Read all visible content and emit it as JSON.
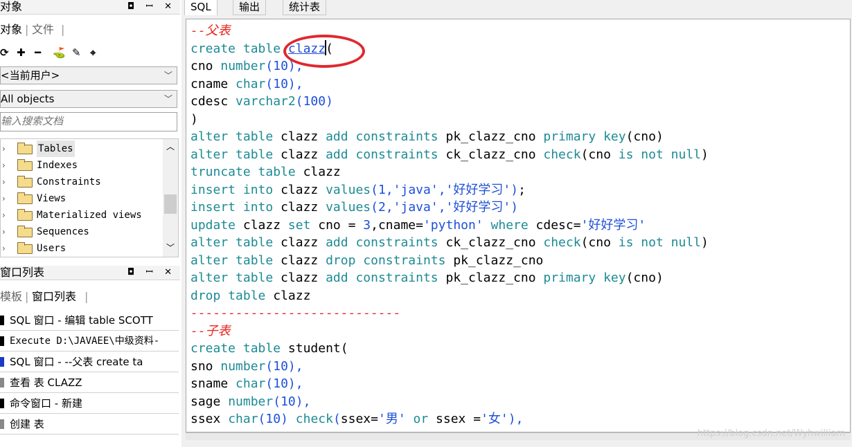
{
  "objects_panel": {
    "title": "对象",
    "controls": "◘ ꟷ ✕",
    "tabs": [
      "对象",
      "文件"
    ],
    "toolbar_icons": [
      "refresh-icon",
      "add-icon",
      "remove-icon",
      "find-icon",
      "filter-icon",
      "properties-icon"
    ],
    "user_select": "<当前用户>",
    "type_select": "All objects",
    "search_placeholder": "输入搜索文档",
    "tree": [
      {
        "label": "Tables"
      },
      {
        "label": "Indexes"
      },
      {
        "label": "Constraints"
      },
      {
        "label": "Views"
      },
      {
        "label": "Materialized views"
      },
      {
        "label": "Sequences"
      },
      {
        "label": "Users"
      }
    ]
  },
  "window_list_panel": {
    "title": "窗口列表",
    "controls": "◘ ꟷ ✕",
    "tabs": [
      "模板",
      "窗口列表"
    ],
    "items": [
      {
        "text": "SQL 窗口 - 编辑 table SCOTT"
      },
      {
        "text": "Execute D:\\JAVAEE\\中级资料-"
      },
      {
        "text": "SQL 窗口 - --父表 create ta"
      },
      {
        "text": "查看 表 CLAZZ"
      },
      {
        "text": "命令窗口 - 新建"
      },
      {
        "text": "创建 表"
      }
    ]
  },
  "editor_tabs": [
    "SQL",
    "输出",
    "统计表"
  ],
  "sql_lines": [
    "--父表",
    "create table clazz(",
    "cno number(10),",
    "cname char(10),",
    "cdesc varchar2(100)",
    ")",
    "alter table clazz add constraints pk_clazz_cno primary key(cno)",
    "alter table clazz add constraints ck_clazz_cno check(cno is not null)",
    "truncate table clazz",
    "insert into clazz values(1,'java','好好学习');",
    "insert into clazz values(2,'java','好好学习')",
    "update clazz set cno = 3,cname='python' where cdesc='好好学习'",
    "alter table clazz add constraints ck_clazz_cno check(cno is not null)",
    "alter table clazz drop constraints pk_clazz_cno",
    "alter table clazz add constraints pk_clazz_cno primary key(cno)",
    "drop table clazz",
    "----------------------------",
    "--子表",
    "create table student(",
    "sno number(10),",
    "sname char(10),",
    "sage number(10),",
    "ssex char(10) check(ssex='男' or ssex ='女'),"
  ],
  "watermark": "https://blog.csdn.net/Wyhwilliam",
  "colors": {
    "keyword": "#1d8a94",
    "comment": "#e8251e",
    "string": "#1d4fd9",
    "annotation": "#e0282e"
  }
}
